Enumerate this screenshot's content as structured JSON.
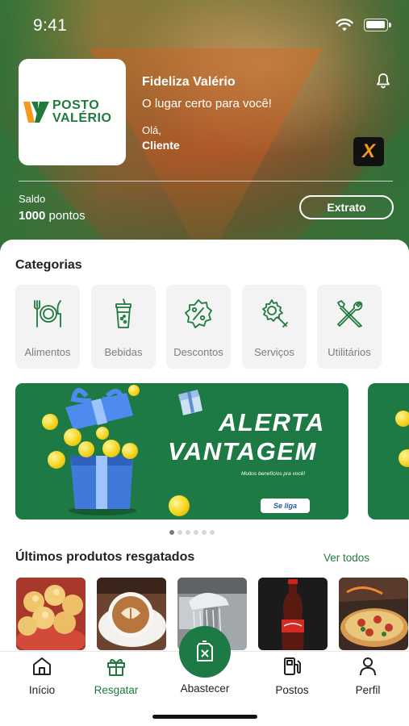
{
  "status_bar": {
    "time": "9:41"
  },
  "header": {
    "logo_line1": "POSTO",
    "logo_line2": "VALÉRIO",
    "program_title": "Fideliza Valério",
    "tagline": "O lugar certo para você!",
    "greeting": "Olá,",
    "user_name": "Cliente",
    "partner_badge": "X"
  },
  "balance": {
    "label": "Saldo",
    "amount": "1000",
    "unit": "pontos",
    "statement_button": "Extrato"
  },
  "categories": {
    "title": "Categorias",
    "items": [
      {
        "label": "Alimentos",
        "icon": "plate-cutlery-icon"
      },
      {
        "label": "Bebidas",
        "icon": "drink-cup-icon"
      },
      {
        "label": "Descontos",
        "icon": "discount-badge-icon"
      },
      {
        "label": "Serviços",
        "icon": "gear-wrench-icon"
      },
      {
        "label": "Utilitários",
        "icon": "tools-icon"
      }
    ]
  },
  "banner": {
    "title_line1": "ALERTA",
    "title_line2": "VANTAGEM",
    "subtitle": "Muitos benefícios pra você!",
    "cta": "Se liga",
    "slides_total": 6,
    "active_slide": 1
  },
  "products": {
    "title": "Últimos produtos resgatados",
    "see_all": "Ver todos",
    "items": [
      {
        "icon": "cheese-bread-image"
      },
      {
        "icon": "cappuccino-image"
      },
      {
        "icon": "car-wash-image"
      },
      {
        "icon": "cola-bottle-image"
      },
      {
        "icon": "pizza-image"
      }
    ]
  },
  "bottom_nav": {
    "items": [
      {
        "label": "Início",
        "icon": "home-icon",
        "active": false
      },
      {
        "label": "Resgatar",
        "icon": "gift-icon",
        "active": true
      },
      {
        "label": "Abastecer",
        "icon": "fuel-can-icon",
        "active": false
      },
      {
        "label": "Postos",
        "icon": "gas-station-icon",
        "active": false
      },
      {
        "label": "Perfil",
        "icon": "user-icon",
        "active": false
      }
    ]
  },
  "colors": {
    "brand_green": "#1e7a44",
    "brand_orange": "#f39a1e",
    "text_muted": "#7d7d7d"
  }
}
